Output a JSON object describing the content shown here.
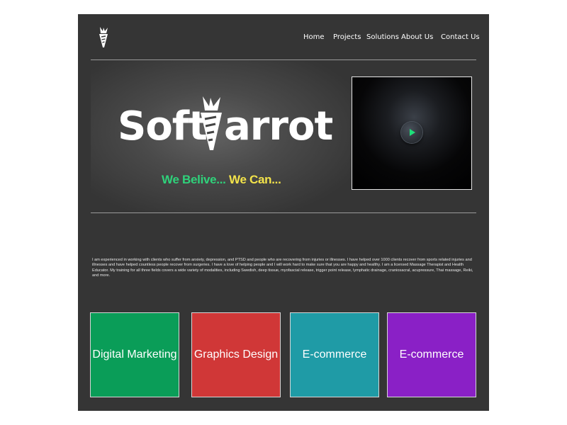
{
  "brand": {
    "name_left": "Soft",
    "name_right": "arrot",
    "tagline_part1": "We Belive...",
    "tagline_part2": "We Can...",
    "tagline_colors": [
      "#2fd27b",
      "#f3e34a"
    ]
  },
  "nav": {
    "items": [
      {
        "label": "Home"
      },
      {
        "label": "Projects"
      },
      {
        "label": "Solutions"
      },
      {
        "label": "About Us"
      },
      {
        "label": "Contact Us"
      }
    ]
  },
  "video": {
    "icon": "play-icon",
    "accent": "#1ee07a"
  },
  "about": {
    "text": "I am experienced in working with clients who suffer from anxiety, depression, and PTSD and people who are recovering from injuries or illnesses. I have helped over 1000 clients recover from sports related injuries and illnesses and have helped countless people recover from surgeries. I have a love of helping people and I will work hard to make sure that you are happy and healthy. I am a licensed Massage Therapist and Health Educator. My training for all three fields covers a wide variety of modalities, including Swedish, deep tissue, myofascial release, trigger point release, lymphatic drainage, craniosacral, acupressure, Thai massage, Reiki, and more."
  },
  "services": [
    {
      "label": "Digital Marketing",
      "color": "#0a9d58"
    },
    {
      "label": "Graphics Design",
      "color": "#d03737"
    },
    {
      "label": "E-commerce",
      "color": "#1f9ba6"
    },
    {
      "label": "E-commerce",
      "color": "#8a20c6"
    }
  ],
  "colors": {
    "page_bg": "#353535",
    "text": "#ffffff"
  }
}
